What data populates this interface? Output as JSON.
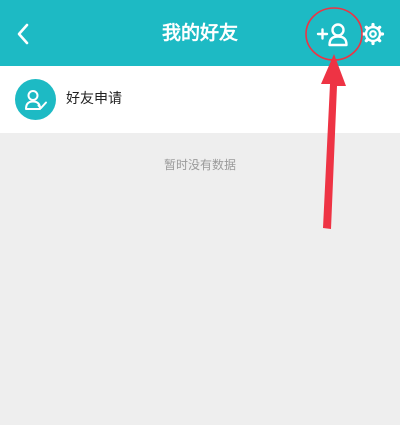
{
  "header": {
    "title": "我的好友",
    "back_icon": "chevron-left-icon",
    "add_friend_icon": "add-person-icon",
    "settings_icon": "gear-icon",
    "background_color": "#1dbac4"
  },
  "list": {
    "items": [
      {
        "label": "好友申请",
        "icon": "friend-request-icon"
      }
    ]
  },
  "empty_state": {
    "text": "暂时没有数据"
  },
  "annotation": {
    "color": "#ee3344"
  }
}
